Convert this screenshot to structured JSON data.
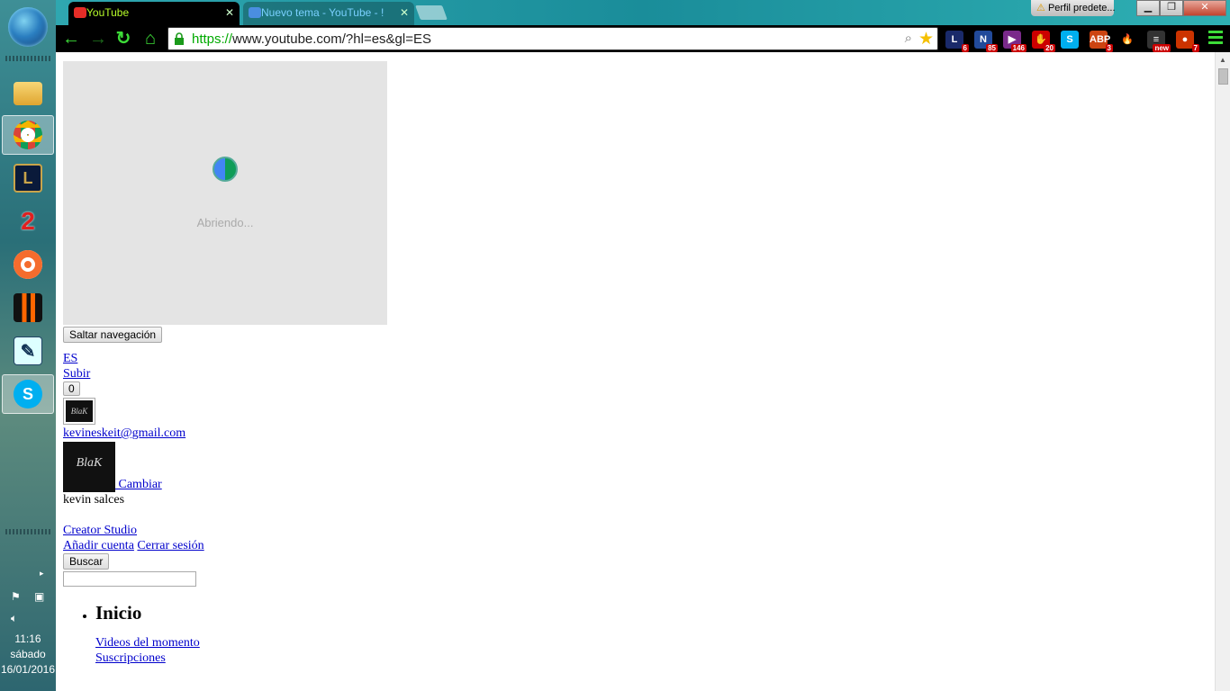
{
  "taskbar": {
    "items": [
      {
        "name": "file-explorer"
      },
      {
        "name": "chrome",
        "active": true
      },
      {
        "name": "league-of-legends",
        "label": "L"
      },
      {
        "name": "guild-wars-2",
        "label": "2"
      },
      {
        "name": "origin"
      },
      {
        "name": "black-ops"
      },
      {
        "name": "notepad"
      },
      {
        "name": "skype",
        "label": "S"
      }
    ],
    "clock": {
      "time": "11:16",
      "day": "sábado",
      "date": "16/01/2016"
    }
  },
  "browser": {
    "tabs": [
      {
        "title": "YouTube",
        "active": true
      },
      {
        "title": "Nuevo tema - YouTube - !",
        "active": false
      }
    ],
    "profile_label": "Perfil predete...",
    "window_buttons": {
      "minimize": "▁",
      "maximize": "❐",
      "close": "✕"
    },
    "url": {
      "scheme": "https://",
      "host": "www.youtube.com",
      "path": "/?hl=es&gl=ES"
    },
    "extensions": [
      {
        "name": "league-ext",
        "label": "L",
        "badge": "6",
        "color": "#1a2a6a"
      },
      {
        "name": "n-ext",
        "label": "N",
        "badge": "85",
        "color": "#224a9a"
      },
      {
        "name": "twitch-ext",
        "label": "▶",
        "badge": "146",
        "color": "#7a2a8a"
      },
      {
        "name": "stop-ext",
        "label": "✋",
        "badge": "20",
        "color": "#c00"
      },
      {
        "name": "skype-ext",
        "label": "S",
        "badge": "",
        "color": "#00aff0"
      },
      {
        "name": "adblock-ext",
        "label": "ABP",
        "badge": "3",
        "color": "#c41"
      },
      {
        "name": "flame-ext",
        "label": "🔥",
        "badge": "",
        "color": "#000"
      },
      {
        "name": "news-ext",
        "label": "≡",
        "badge": "new",
        "color": "#333"
      },
      {
        "name": "profile-ext",
        "label": "●",
        "badge": "7",
        "color": "#c30"
      }
    ]
  },
  "page": {
    "loading_text": "Abriendo...",
    "skip_nav": "Saltar navegación",
    "lang": "ES",
    "upload": "Subir",
    "notif_count": "0",
    "email": "kevineskeit@gmail.com",
    "change": "Cambiar",
    "user_name": "kevin salces",
    "creator_studio": "Creator Studio",
    "add_account": "Añadir cuenta",
    "sign_out": "Cerrar sesión",
    "search_button": "Buscar",
    "home": "Inicio",
    "nav_links": [
      "Videos del momento",
      "Suscripciones"
    ]
  }
}
